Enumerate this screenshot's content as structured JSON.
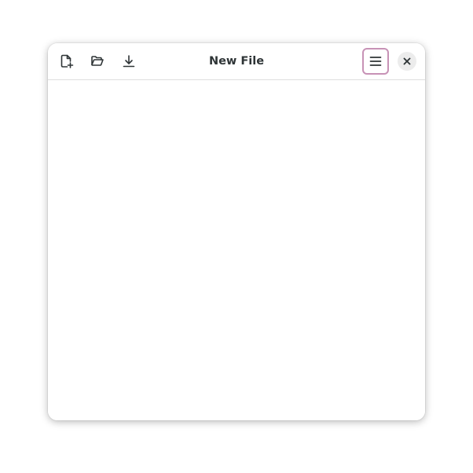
{
  "window": {
    "title": "New File"
  },
  "headerbar": {
    "buttons": [
      {
        "name": "new-file",
        "icon": "document-new-icon"
      },
      {
        "name": "open-file",
        "icon": "folder-open-icon"
      },
      {
        "name": "save-file",
        "icon": "download-icon"
      },
      {
        "name": "main-menu",
        "icon": "hamburger-menu-icon"
      },
      {
        "name": "close",
        "icon": "close-icon"
      }
    ],
    "menu_focus_color": "#c792b6"
  },
  "editor": {
    "text": ""
  }
}
